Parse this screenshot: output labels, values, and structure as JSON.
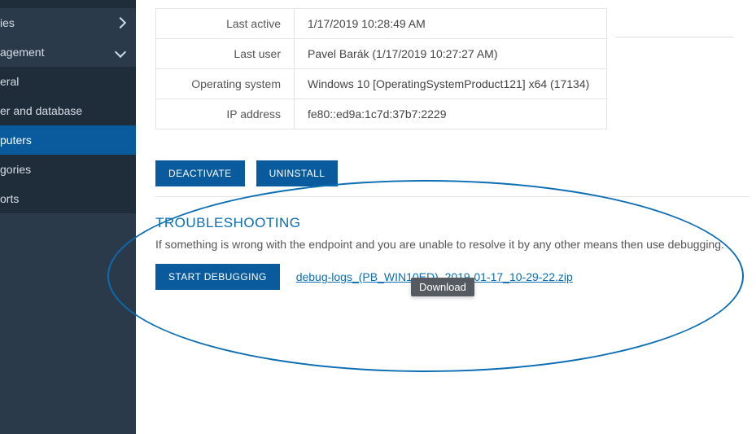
{
  "sidebar": {
    "items": [
      {
        "label": "ies",
        "chevron": "right",
        "kind": "group"
      },
      {
        "label": "agement",
        "chevron": "down",
        "kind": "group"
      },
      {
        "label": "eral",
        "kind": "sub"
      },
      {
        "label": "er and database",
        "kind": "sub"
      },
      {
        "label": "puters",
        "kind": "sub",
        "active": true
      },
      {
        "label": "gories",
        "kind": "sub"
      },
      {
        "label": "orts",
        "kind": "sub"
      }
    ]
  },
  "details": {
    "rows": [
      {
        "label": "Last active",
        "value": "1/17/2019 10:28:49 AM"
      },
      {
        "label": "Last user",
        "value": "Pavel Barák (1/17/2019 10:27:27 AM)"
      },
      {
        "label": "Operating system",
        "value": "Windows 10 [OperatingSystemProduct121] x64 (17134)"
      },
      {
        "label": "IP address",
        "value": "fe80::ed9a:1c7d:37b7:2229"
      }
    ]
  },
  "actions": {
    "deactivate": "DEACTIVATE",
    "uninstall": "UNINSTALL"
  },
  "troubleshooting": {
    "title": "TROUBLESHOOTING",
    "desc": "If something is wrong with the endpoint and you are unable to resolve it by any other means then use debugging.",
    "start_btn": "START DEBUGGING",
    "log_link": "debug-logs_(PB_WIN10ED)_2019-01-17_10-29-22.zip"
  },
  "tooltip": {
    "text": "Download"
  }
}
